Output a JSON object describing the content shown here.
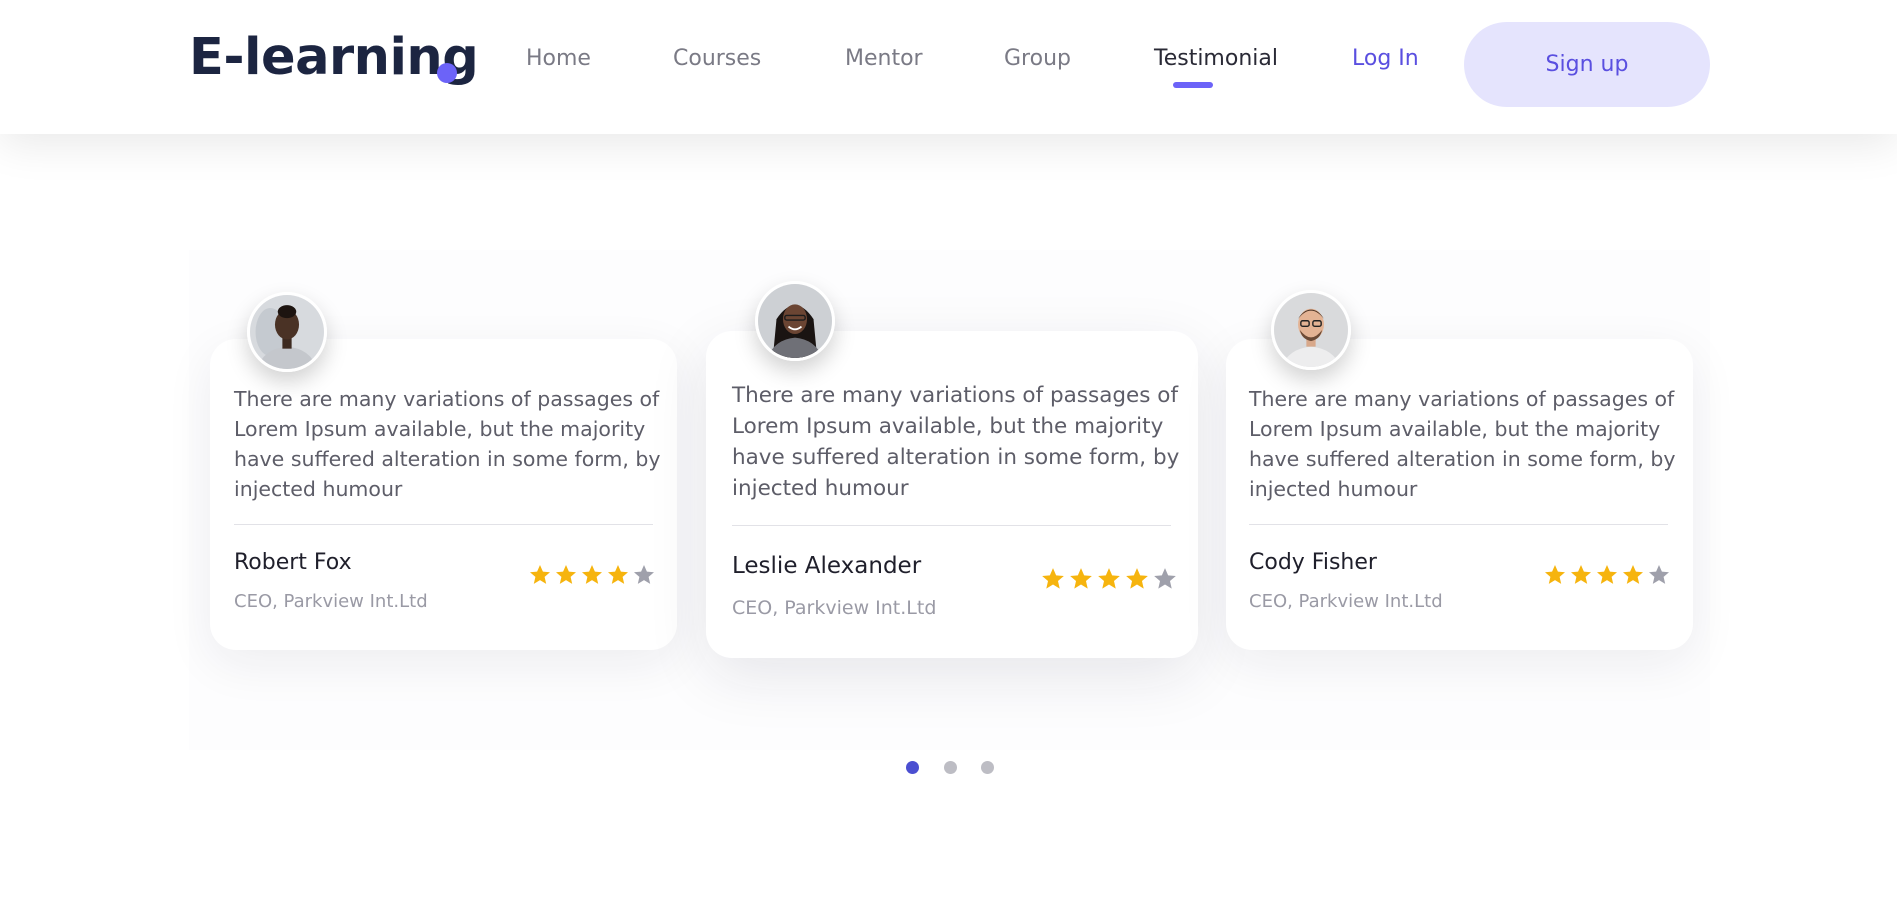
{
  "header": {
    "logo": "E-learning",
    "nav": [
      "Home",
      "Courses",
      "Mentor",
      "Group",
      "Testimonial"
    ],
    "active_nav": "Testimonial",
    "login": "Log In",
    "signup": "Sign up"
  },
  "testimonials": [
    {
      "quote": "There are many variations of passages of Lorem Ipsum available, but the majority have suffered alteration in some form, by injected humour",
      "name": "Robert Fox",
      "role": "CEO, Parkview Int.Ltd",
      "rating": 4,
      "max_rating": 5
    },
    {
      "quote": "There are many variations of passages of Lorem Ipsum available, but the majority have suffered alteration in some form, by injected humour",
      "name": "Leslie Alexander",
      "role": "CEO, Parkview Int.Ltd",
      "rating": 4,
      "max_rating": 5
    },
    {
      "quote": "There are many variations of passages of Lorem Ipsum available, but the majority have suffered alteration in some form, by injected humour",
      "name": "Cody Fisher",
      "role": "CEO, Parkview Int.Ltd",
      "rating": 4,
      "max_rating": 5
    }
  ],
  "pagination": {
    "count": 3,
    "active": 1
  },
  "colors": {
    "accent": "#6c63f8",
    "star_filled": "#f6b40e",
    "star_empty": "#9fa0ab",
    "dot_active": "#4b4fd1"
  }
}
